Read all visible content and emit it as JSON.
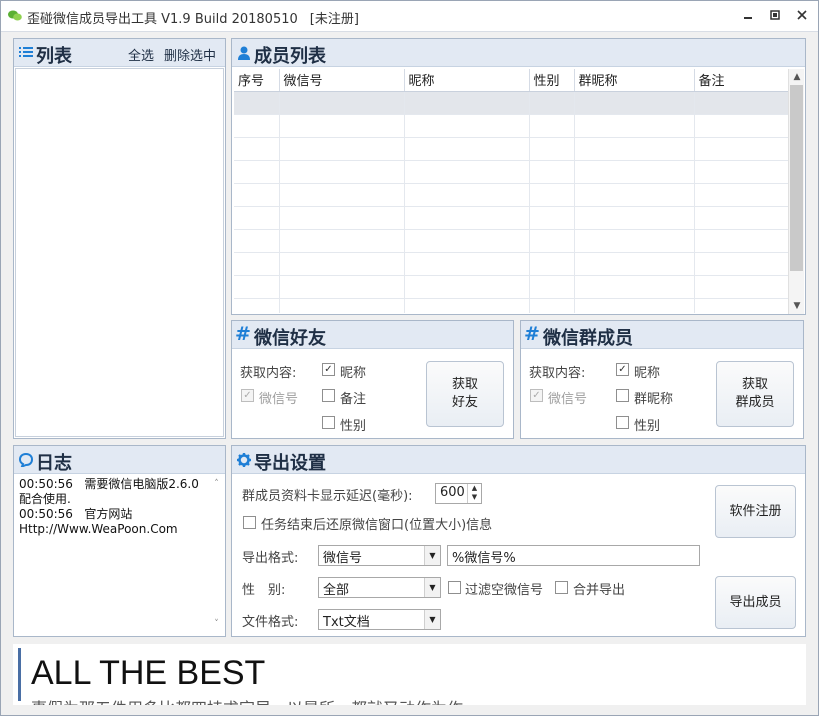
{
  "window": {
    "title": "歪碰微信成员导出工具 V1.9 Build 20180510",
    "status": "[未注册]",
    "controls": {
      "minimize": "▭",
      "maximize": "▢",
      "close": "✕"
    }
  },
  "list_panel": {
    "title": "列表",
    "select_all": "全选",
    "delete_selected": "删除选中"
  },
  "members_panel": {
    "title": "成员列表",
    "columns": [
      "序号",
      "微信号",
      "昵称",
      "性别",
      "群昵称",
      "备注"
    ]
  },
  "friends_panel": {
    "title": "微信好友",
    "fetch_label": "获取内容:",
    "options": {
      "wechat_id": "微信号",
      "nickname": "昵称",
      "remark": "备注",
      "gender": "性别"
    },
    "checked": {
      "wechat_id": true,
      "nickname": true,
      "remark": false,
      "gender": false
    },
    "button_line1": "获取",
    "button_line2": "好友"
  },
  "group_panel": {
    "title": "微信群成员",
    "fetch_label": "获取内容:",
    "options": {
      "wechat_id": "微信号",
      "nickname": "昵称",
      "group_nickname": "群昵称",
      "gender": "性别"
    },
    "checked": {
      "wechat_id": true,
      "nickname": true,
      "group_nickname": false,
      "gender": false
    },
    "button_line1": "获取",
    "button_line2": "群成员"
  },
  "log_panel": {
    "title": "日志",
    "text": "00:50:56   需要微信电脑版2.6.0\n配合使用.\n00:50:56   官方网站\nHttp://Www.WeaPoon.Com"
  },
  "export_panel": {
    "title": "导出设置",
    "delay_label": "群成员资料卡显示延迟(毫秒):",
    "delay_value": "600",
    "restore_label": "任务结束后还原微信窗口(位置大小)信息",
    "format_label": "导出格式:",
    "format_value": "微信号",
    "format_template": "%微信号%",
    "gender_label": "性　别:",
    "gender_value": "全部",
    "filter_empty_label": "过滤空微信号",
    "merge_label": "合并导出",
    "file_format_label": "文件格式:",
    "file_format_value": "Txt文档",
    "register_button": "软件注册",
    "export_button": "导出成员"
  },
  "banner": {
    "headline": "ALL THE BEST",
    "subline": "事假为那五件用多比都四持求字早。以是所，都就又动作为作"
  },
  "colors": {
    "panel_header": "#e2e9f3",
    "icon_blue": "#1f7fd6",
    "border": "#a9b7c9"
  }
}
